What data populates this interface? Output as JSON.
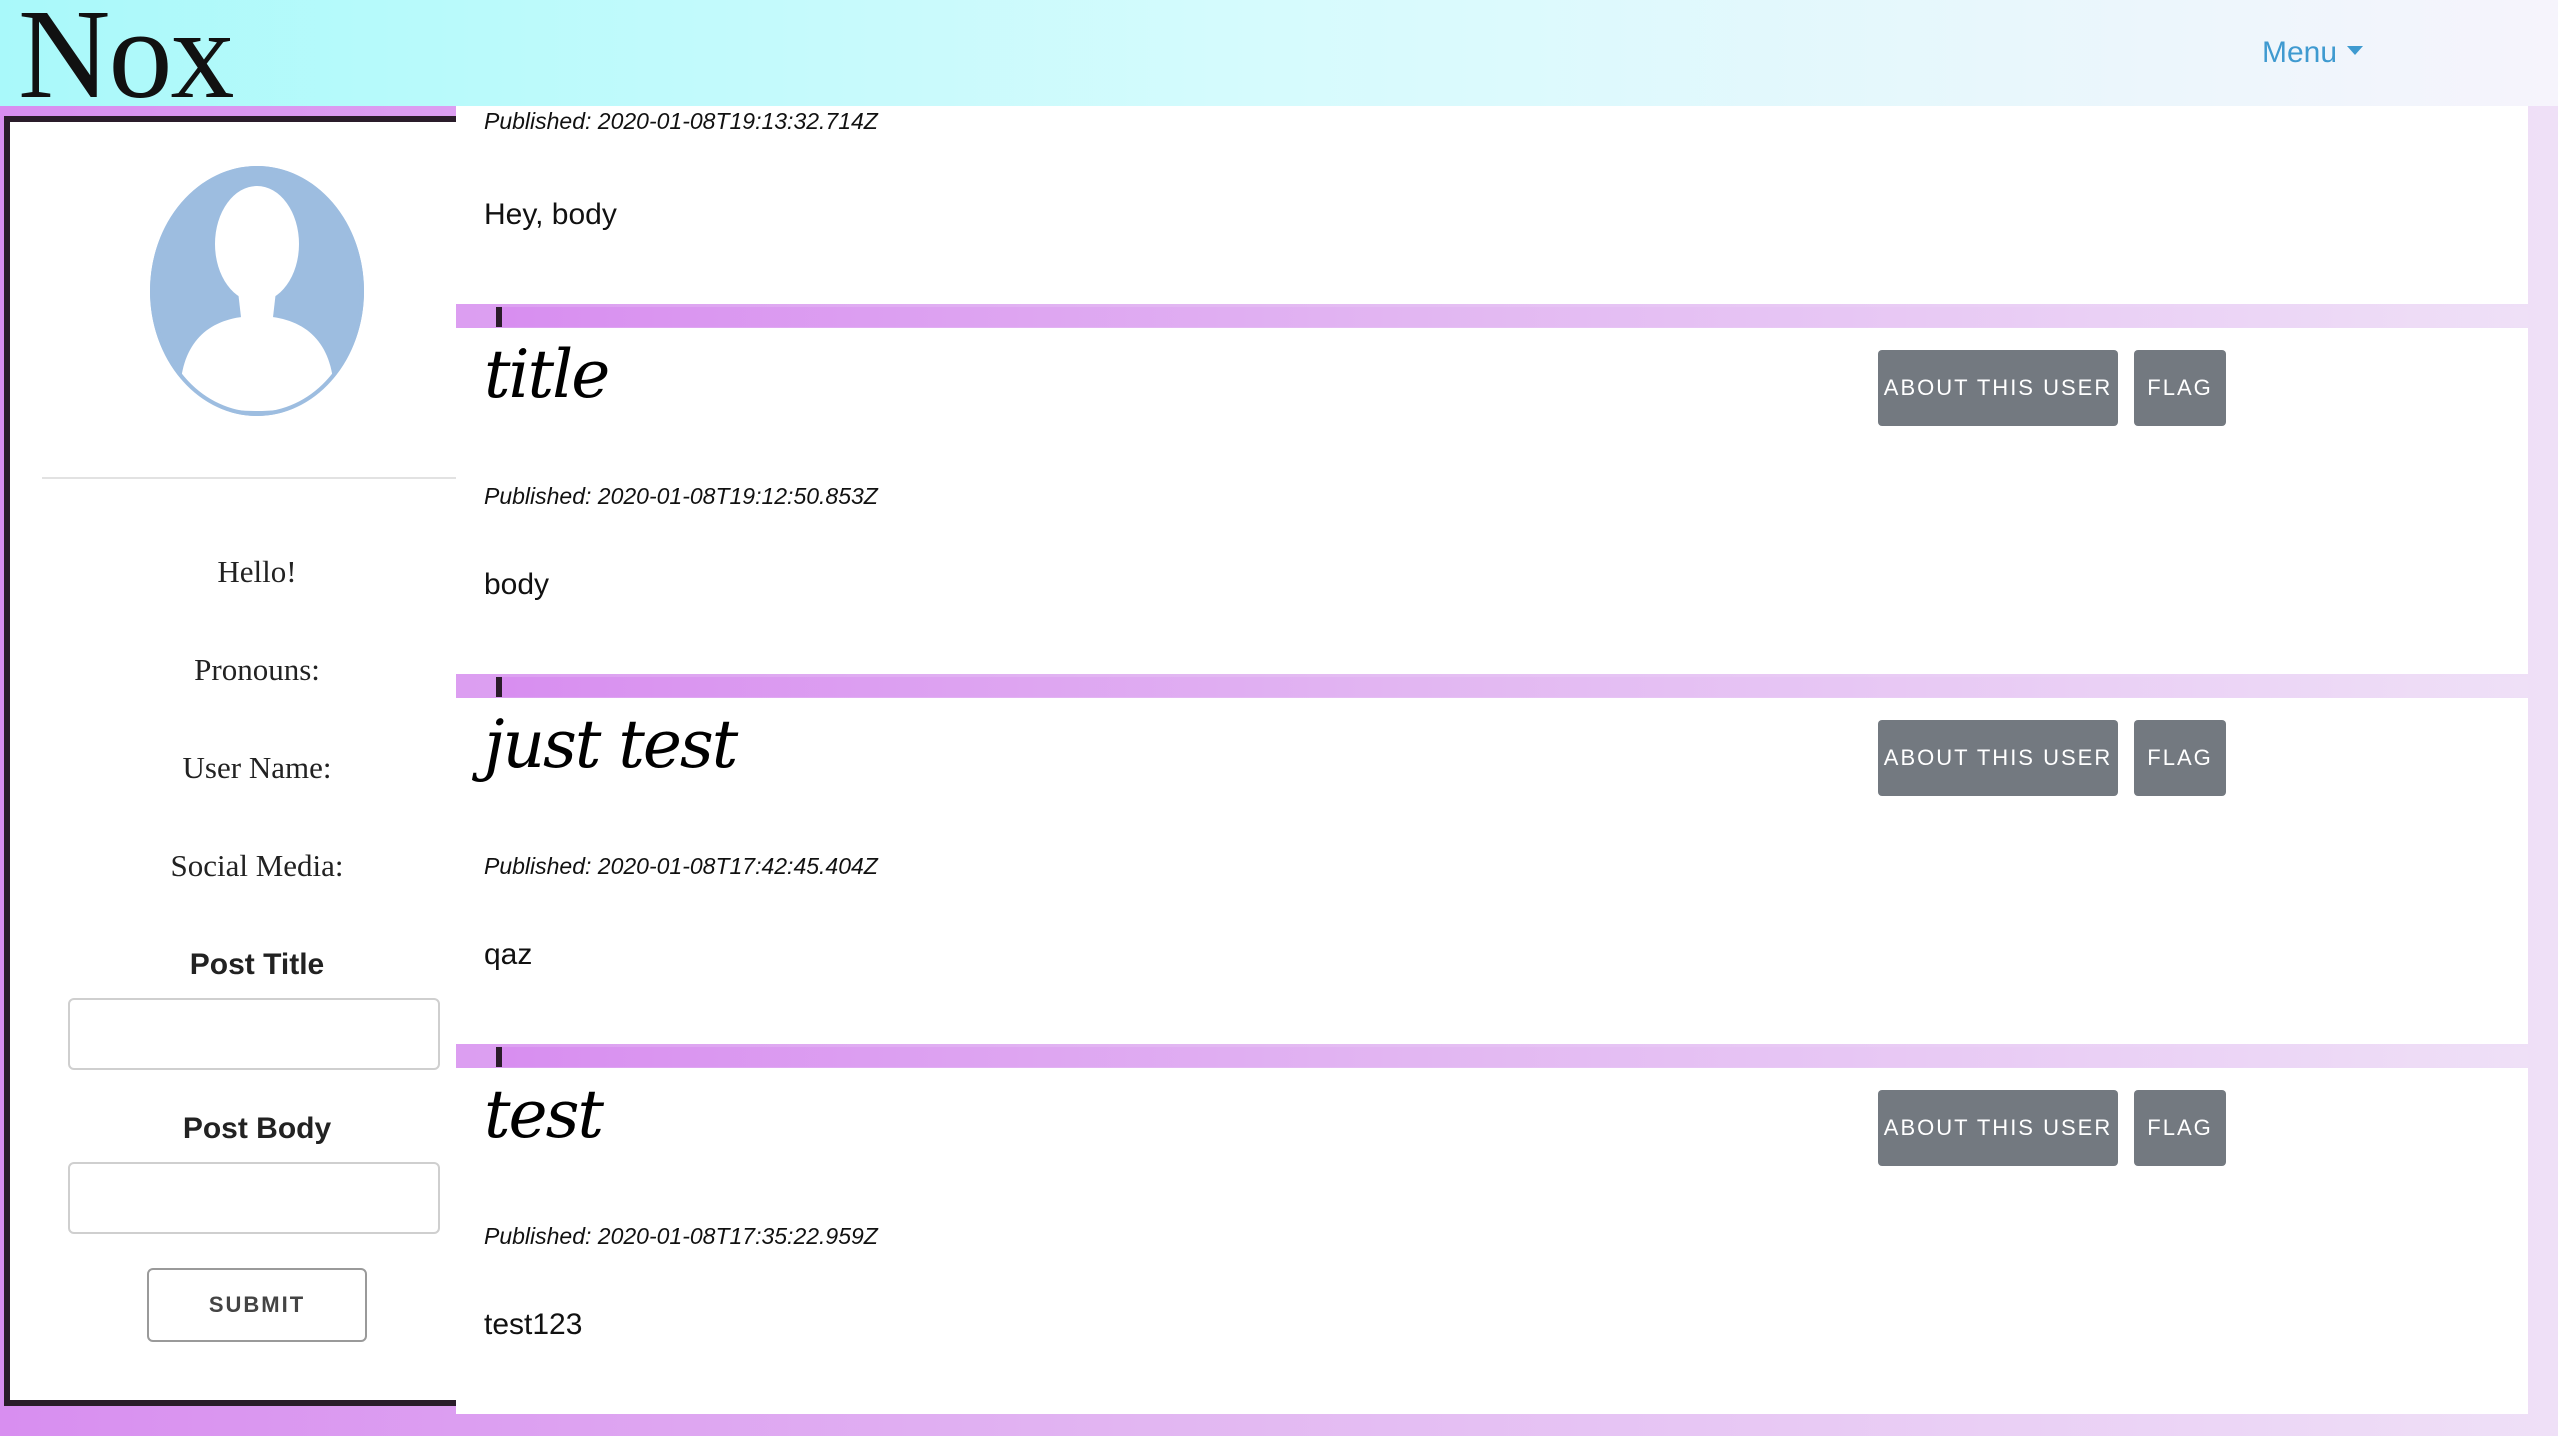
{
  "header": {
    "logo": "Nox",
    "menu_label": "Menu"
  },
  "profile": {
    "avatar": "user-silhouette-icon",
    "greeting": "Hello!",
    "pronouns_label": "Pronouns:",
    "username_label": "User Name:",
    "social_label": "Social Media:",
    "post_title_label": "Post Title",
    "post_title_value": "",
    "post_body_label": "Post Body",
    "post_body_value": "",
    "submit_label": "SUBMIT"
  },
  "posts": [
    {
      "title": "",
      "published": "Published: 2020-01-08T19:13:32.714Z",
      "body": "Hey, body"
    },
    {
      "title": "title",
      "published": "Published: 2020-01-08T19:12:50.853Z",
      "body": "body",
      "about_label": "ABOUT THIS USER",
      "flag_label": "FLAG"
    },
    {
      "title": "just test",
      "published": "Published: 2020-01-08T17:42:45.404Z",
      "body": "qaz",
      "about_label": "ABOUT THIS USER",
      "flag_label": "FLAG"
    },
    {
      "title": "test",
      "published": "Published: 2020-01-08T17:35:22.959Z",
      "body": "test123",
      "about_label": "ABOUT THIS USER",
      "flag_label": "FLAG"
    }
  ],
  "colors": {
    "accent": "#3f9ad0",
    "button": "#737980",
    "gradient_start": "#d88ef0",
    "header_start": "#a9f9fa"
  }
}
